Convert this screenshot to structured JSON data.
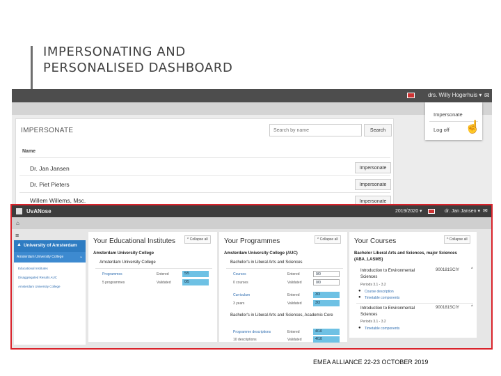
{
  "slide": {
    "title_line1": "IMPERSONATING AND",
    "title_line2": "PERSONALISED DASHBOARD",
    "footer": "EMEA ALLIANCE   22-23 OCTOBER 2019"
  },
  "impersonate": {
    "user_menu": "drs. Willy Hogerhuis ▾",
    "mail_icon": "mail-icon",
    "dropdown": [
      "Impersonate",
      "Log off"
    ],
    "title": "IMPERSONATE",
    "search_placeholder": "Search by name",
    "search_button": "Search",
    "name_header": "Name",
    "rows": [
      {
        "name": "Dr. Jan Jansen",
        "action": "Impersonate"
      },
      {
        "name": "Dr. Piet Pieters",
        "action": "Impersonate"
      },
      {
        "name": "Willem Willems, Msc.",
        "action": "Impersonate"
      }
    ]
  },
  "dashboard": {
    "brand": "UvANose",
    "year": "2019/2020 ▾",
    "user": "dr. Jan Jansen ▾",
    "sidebar": {
      "header": "University of Amsterdam",
      "selected": "Amsterdam University College",
      "items": [
        "Educational Institutes",
        "Disaggregated Results AUC",
        "Amsterdam University College"
      ]
    },
    "institutes": {
      "title": "Your Educational Institutes",
      "collapse": "^ Collapse all",
      "subtitle": "Amsterdam University College",
      "group": "Amsterdam University College",
      "rows": [
        {
          "label": "Programmes",
          "status": "Entered",
          "value": "5/5"
        },
        {
          "label": "5 programmes",
          "status": "Validated",
          "value": "0/5"
        }
      ]
    },
    "programmes": {
      "title": "Your Programmes",
      "collapse": "^ Collapse all",
      "subtitle": "Amsterdam University College (AUC)",
      "group1": "Bachelor's in Liberal Arts and Sciences",
      "group1_rows": [
        {
          "label": "Courses",
          "status": "Entered",
          "value": "0/0"
        },
        {
          "label": "0 courses",
          "status": "Validated",
          "value": "0/0"
        },
        {
          "label": "Curriculum",
          "status": "Entered",
          "value": "3/3"
        },
        {
          "label": "3 years",
          "status": "Validated",
          "value": "3/3"
        }
      ],
      "group2": "Bachelor's in Liberal Arts and Sciences, Academic Core",
      "group2_rows": [
        {
          "label": "Programme descriptions",
          "status": "Entered",
          "value": "4/10"
        },
        {
          "label": "10 descriptions",
          "status": "Validated",
          "value": "4/10"
        }
      ]
    },
    "courses": {
      "title": "Your Courses",
      "collapse": "^ Collapse all",
      "subtitle": "Bachelor Liberal Arts and Sciences, major Sciences (ABA_LASMS)",
      "course1": {
        "name": "Introduction to Environmental Sciences",
        "code": "900181SCIY",
        "periods": "Periods 3.1 - 3.2",
        "links": [
          "Course description",
          "Timetable components"
        ]
      },
      "course2": {
        "name": "Introduction to Environmental Sciences",
        "code": "900181SCIY",
        "periods": "Periods 3.1 - 3.2",
        "links": [
          "Timetable components"
        ]
      }
    }
  }
}
